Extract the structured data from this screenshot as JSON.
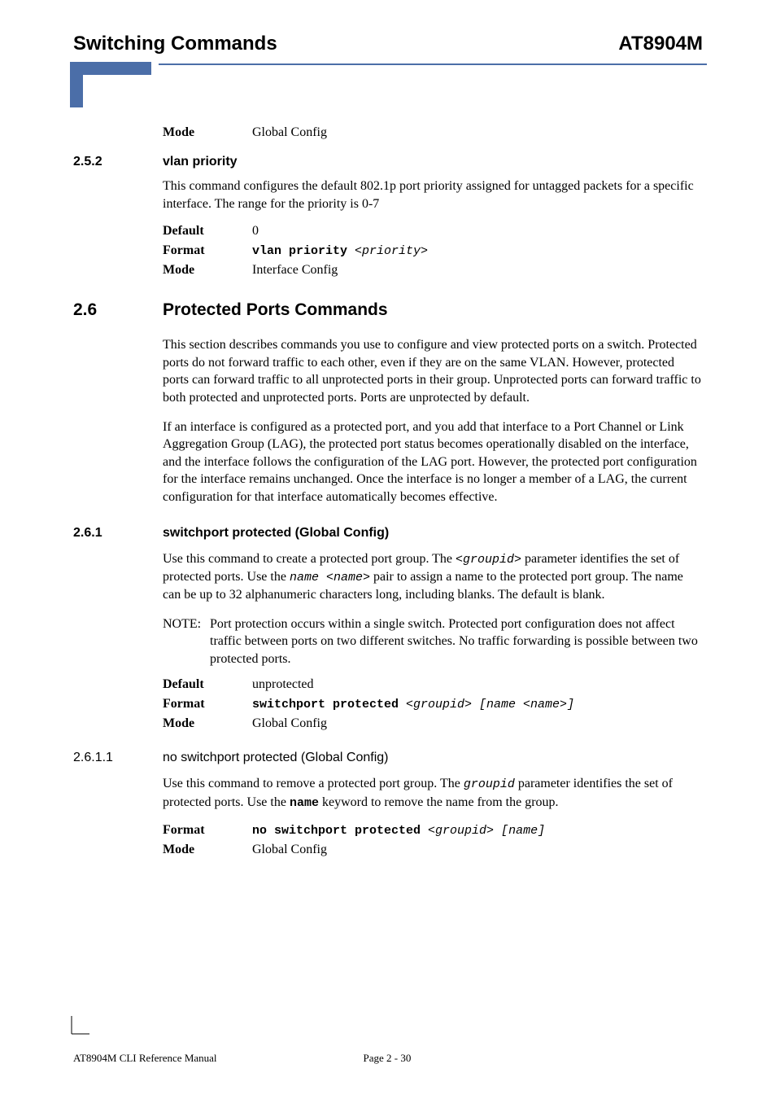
{
  "header": {
    "left": "Switching Commands",
    "right": "AT8904M"
  },
  "s1": {
    "mode_label": "Mode",
    "mode_value": "Global Config"
  },
  "s252": {
    "num": "2.5.2",
    "title": "vlan priority",
    "para": "This command configures the default 802.1p port priority assigned for untagged packets for a specific interface. The range for the priority is 0-7",
    "default_label": "Default",
    "default_value": "0",
    "format_label": "Format",
    "format_cmd": "vlan priority ",
    "format_arg": "<priority>",
    "mode_label": "Mode",
    "mode_value": "Interface Config"
  },
  "s26": {
    "num": "2.6",
    "title": "Protected Ports Commands",
    "para1": "This section describes commands you use to configure and view protected ports on a switch. Protected ports do not forward traffic to each other, even if they are on the same VLAN. However, protected ports can forward traffic to all unprotected ports in their group. Unprotected ports can forward traffic to both protected and unprotected ports. Ports are unprotected by default.",
    "para2": "If an interface is configured as a protected port, and you add that interface to a Port Channel or Link Aggregation Group (LAG), the protected port status becomes operationally disabled on the interface, and the interface follows the configuration of the LAG port. However, the protected port configuration for the interface remains unchanged. Once the interface is no longer a member of a LAG, the current configuration for that interface automatically becomes effective."
  },
  "s261": {
    "num": "2.6.1",
    "title": "switchport protected (Global Config)",
    "para1_a": "Use this command to create a protected port group. The ",
    "para1_b": "<groupid>",
    "para1_c": " parameter identifies the set of protected ports. Use the ",
    "para1_d": "name <name>",
    "para1_e": " pair to assign a name to the protected port group. The name can be up to 32 alphanumeric characters long, including blanks. The default is blank.",
    "note_label": "NOTE:",
    "note_body": "Port protection occurs within a single switch. Protected port configuration does not affect traffic between ports on two different switches. No traffic forwarding is possible between two protected ports.",
    "default_label": "Default",
    "default_value": "unprotected",
    "format_label": "Format",
    "format_cmd": "switchport protected ",
    "format_arg": "<groupid> [name <name>]",
    "mode_label": "Mode",
    "mode_value": "Global Config"
  },
  "s2611": {
    "num": "2.6.1.1",
    "title": "no switchport protected (Global Config)",
    "para_a": "Use this command to remove a protected port group. The ",
    "para_b": "groupid",
    "para_c": " parameter identifies the set of protected ports. Use the ",
    "para_d": "name",
    "para_e": " keyword to remove the name from the group.",
    "format_label": "Format",
    "format_cmd": "no switchport protected ",
    "format_arg": "<groupid> [name]",
    "mode_label": "Mode",
    "mode_value": "Global Config"
  },
  "footer": {
    "left": "AT8904M CLI Reference Manual",
    "mid": "Page 2 - 30"
  }
}
